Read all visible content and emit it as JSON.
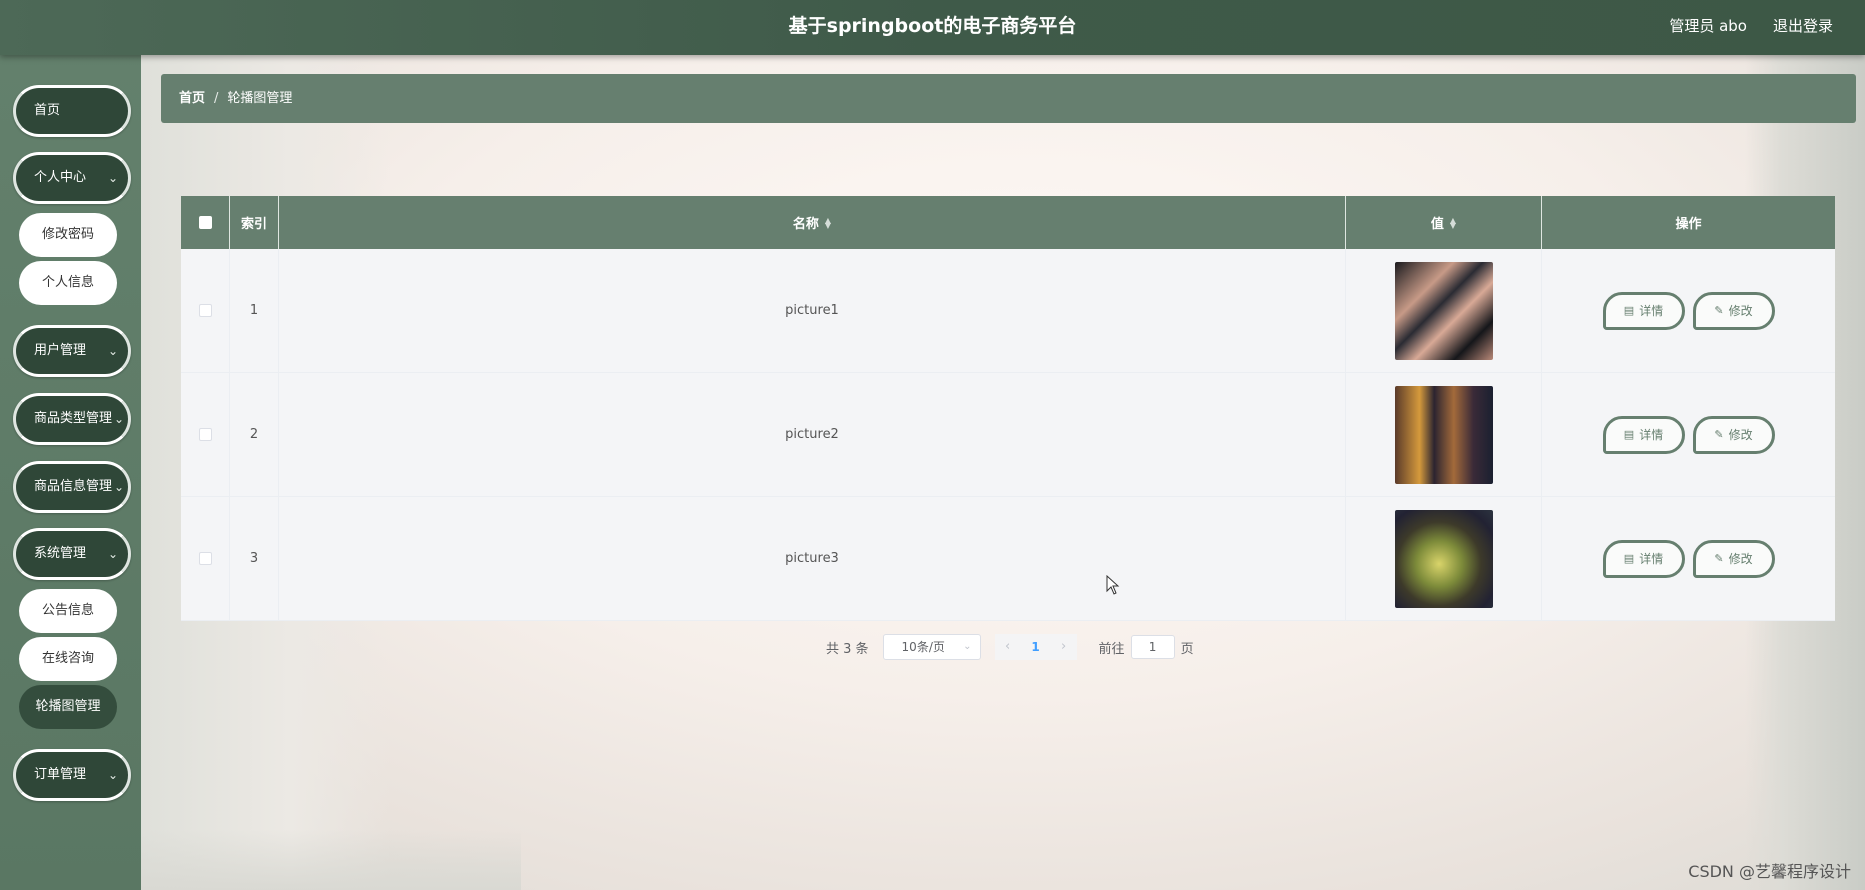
{
  "header": {
    "title": "基于springboot的电子商务平台",
    "admin": "管理员 abo",
    "logout": "退出登录"
  },
  "sidebar": {
    "items": [
      {
        "label": "首页"
      },
      {
        "label": "个人中心",
        "chevron": "chevron-down-icon"
      },
      {
        "label": "修改密码"
      },
      {
        "label": "个人信息"
      },
      {
        "label": "用户管理",
        "chevron": "chevron-down-icon"
      },
      {
        "label": "商品类型管理",
        "chevron": "chevron-down-icon"
      },
      {
        "label": "商品信息管理",
        "chevron": "chevron-down-icon"
      },
      {
        "label": "系统管理",
        "chevron": "chevron-down-icon"
      },
      {
        "label": "公告信息"
      },
      {
        "label": "在线咨询"
      },
      {
        "label": "轮播图管理",
        "active": true
      },
      {
        "label": "订单管理",
        "chevron": "chevron-down-icon"
      }
    ]
  },
  "breadcrumb": {
    "home": "首页",
    "separator": "/",
    "current": "轮播图管理"
  },
  "table": {
    "columns": {
      "index": "索引",
      "name": "名称",
      "value": "值",
      "actions": "操作"
    },
    "rows": [
      {
        "index": "1",
        "name": "picture1",
        "thumb": "image"
      },
      {
        "index": "2",
        "name": "picture2",
        "thumb": "image"
      },
      {
        "index": "3",
        "name": "picture3",
        "thumb": "image"
      }
    ],
    "detail_label": "详情",
    "edit_label": "修改"
  },
  "pagination": {
    "total": "共 3 条",
    "page_size": "10条/页",
    "current_page": "1",
    "goto_prefix": "前往",
    "goto_value": "1",
    "goto_suffix": "页"
  },
  "watermark": "CSDN @艺馨程序设计",
  "colors": {
    "header": "#3f5a49",
    "sidebar": "#5f7c68",
    "accent": "#667f6f",
    "menu_item": "#2f4738"
  }
}
